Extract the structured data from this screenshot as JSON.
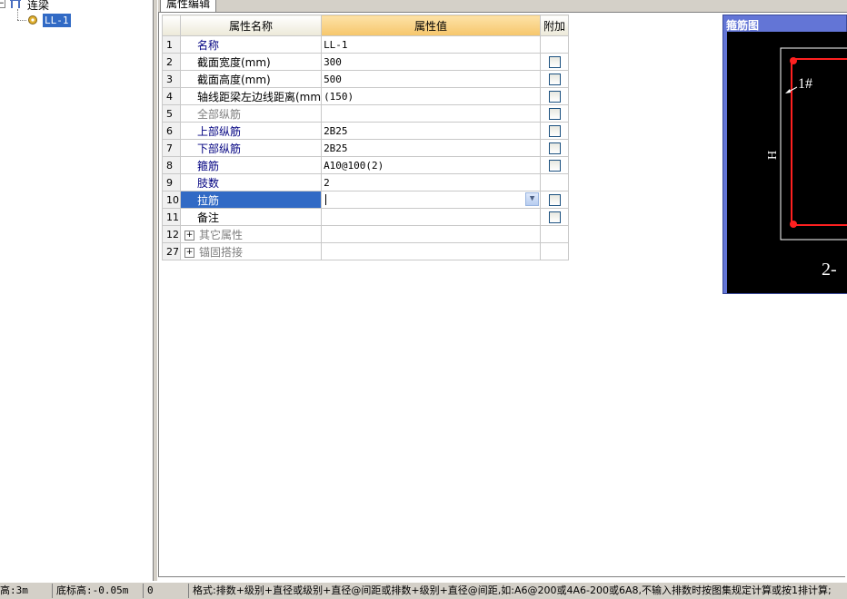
{
  "tree": {
    "root_label": "连梁",
    "child_label": "LL-1"
  },
  "tabs": [
    {
      "label": "属性编辑"
    }
  ],
  "grid": {
    "columns": [
      "属性名称",
      "属性值",
      "附加"
    ],
    "rows": [
      {
        "num": "1",
        "name": "名称",
        "value": "LL-1",
        "checkbox": false,
        "style": "blue"
      },
      {
        "num": "2",
        "name": "截面宽度(mm)",
        "value": "300",
        "checkbox": true,
        "style": "black"
      },
      {
        "num": "3",
        "name": "截面高度(mm)",
        "value": "500",
        "checkbox": true,
        "style": "black"
      },
      {
        "num": "4",
        "name": "轴线距梁左边线距离(mm",
        "value": "(150)",
        "checkbox": true,
        "style": "black"
      },
      {
        "num": "5",
        "name": "全部纵筋",
        "value": "",
        "checkbox": true,
        "style": "gray"
      },
      {
        "num": "6",
        "name": "上部纵筋",
        "value": "2B25",
        "checkbox": true,
        "style": "blue"
      },
      {
        "num": "7",
        "name": "下部纵筋",
        "value": "2B25",
        "checkbox": true,
        "style": "blue"
      },
      {
        "num": "8",
        "name": "箍筋",
        "value": "A10@100(2)",
        "checkbox": true,
        "style": "blue"
      },
      {
        "num": "9",
        "name": "肢数",
        "value": "2",
        "checkbox": false,
        "style": "blue"
      },
      {
        "num": "10",
        "name": "拉筋",
        "value": "",
        "checkbox": true,
        "style": "selected"
      },
      {
        "num": "11",
        "name": "备注",
        "value": "",
        "checkbox": true,
        "style": "black"
      },
      {
        "num": "12",
        "name": "其它属性",
        "value": "",
        "checkbox": false,
        "style": "group"
      },
      {
        "num": "27",
        "name": "锚固搭接",
        "value": "",
        "checkbox": false,
        "style": "group"
      }
    ]
  },
  "stirrup_panel": {
    "title": "箍筋图",
    "bar_label": "1#",
    "height_label": "H",
    "bottom_label": "2-"
  },
  "colors": {
    "stirrup_red": "#ff2020",
    "selection": "#316ac5",
    "panel_title_bg": "#6375d6"
  },
  "statusbar": {
    "floor_height": "高:3m",
    "bottom_elevation": "底标高:-0.05m",
    "zero": "0",
    "format_hint": "格式:排数+级别+直径或级别+直径@间距或排数+级别+直径@间距,如:A6@200或4A6-200或6A8,不输入排数时按图集规定计算或按1排计算;"
  }
}
